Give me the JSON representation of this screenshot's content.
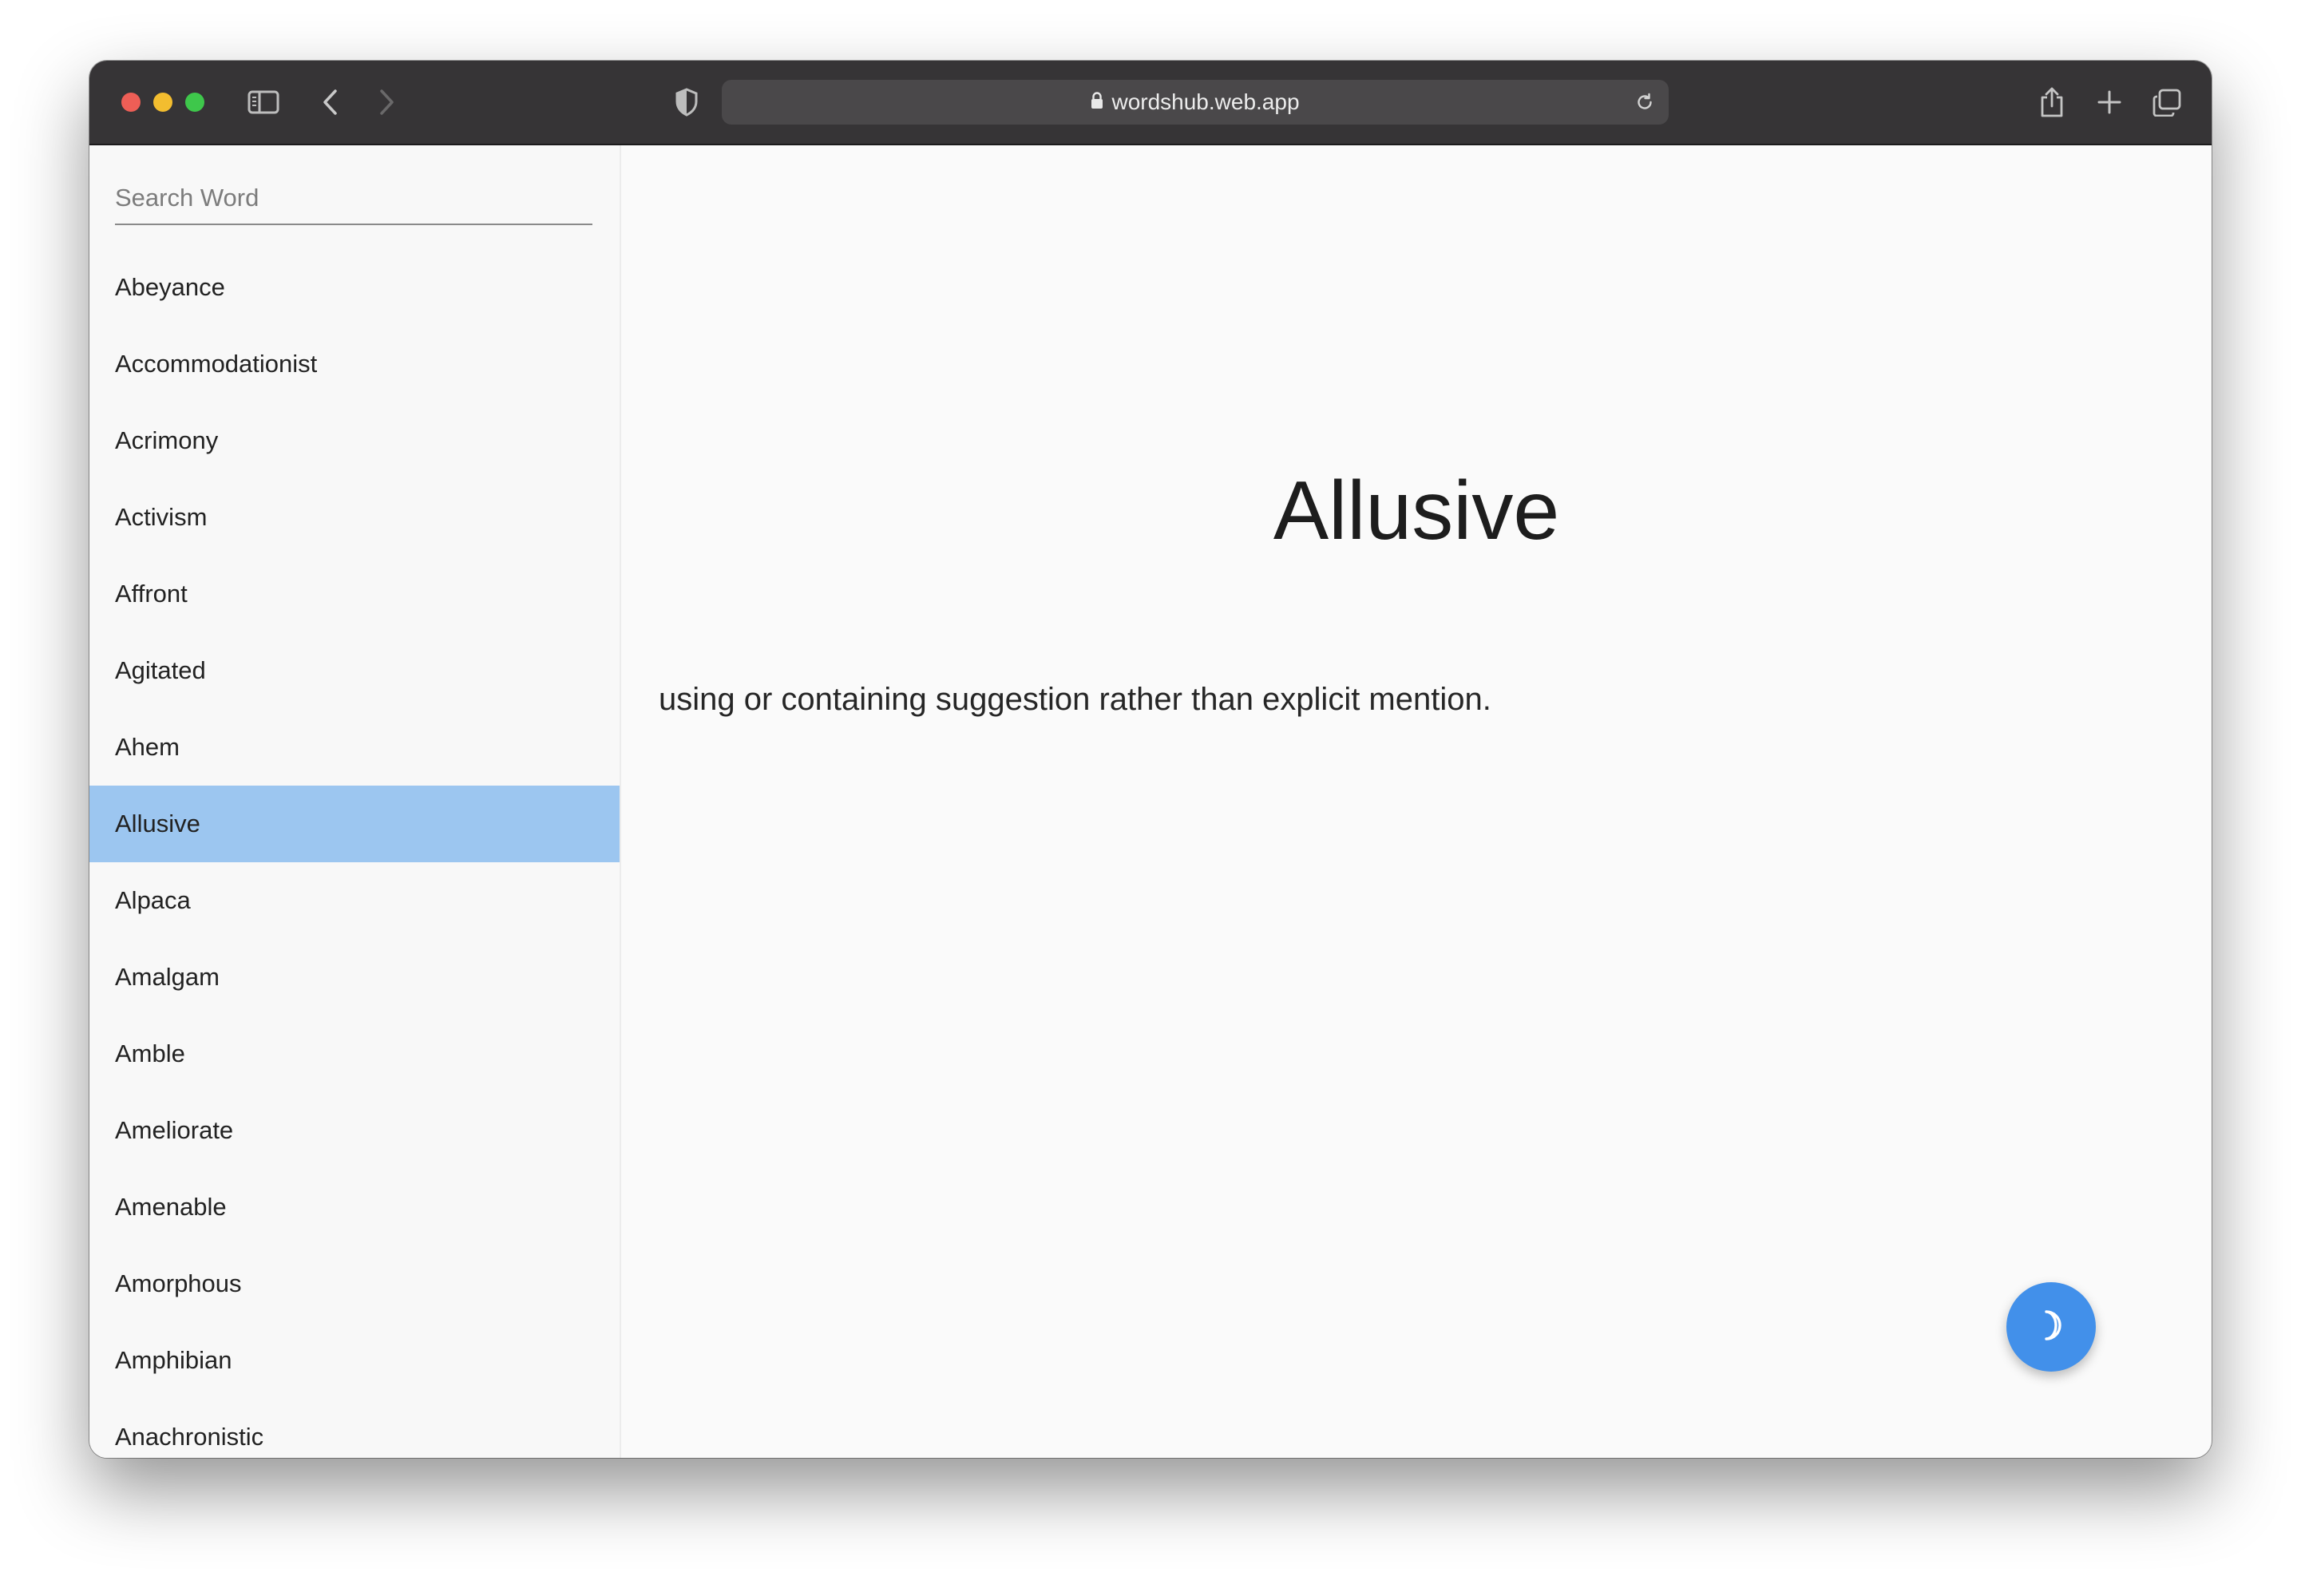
{
  "browser": {
    "url": "wordshub.web.app",
    "icons": {
      "close": "close-button",
      "minimize": "minimize-button",
      "zoom": "zoom-button",
      "sidebar": "sidebar-toggle-icon",
      "back": "chevron-left-icon",
      "forward": "chevron-right-icon",
      "privacy": "shield-icon",
      "lock": "lock-icon",
      "reload": "reload-icon",
      "share": "share-icon",
      "new_tab": "plus-icon",
      "tabs": "tab-overview-icon"
    }
  },
  "sidebar": {
    "search_placeholder": "Search Word",
    "search_value": "",
    "words": [
      "Abeyance",
      "Accommodationist",
      "Acrimony",
      "Activism",
      "Affront",
      "Agitated",
      "Ahem",
      "Allusive",
      "Alpaca",
      "Amalgam",
      "Amble",
      "Ameliorate",
      "Amenable",
      "Amorphous",
      "Amphibian",
      "Anachronistic"
    ],
    "selected_word": "Allusive"
  },
  "main": {
    "word": "Allusive",
    "definition": "using or containing suggestion rather than explicit mention."
  },
  "fab": {
    "icon": "moon-icon",
    "action": "toggle dark mode"
  },
  "colors": {
    "titlebar": "#363436",
    "selected_row": "#9cc6f0",
    "fab": "#4290ea",
    "traffic_red": "#ee5e56",
    "traffic_yellow": "#f3bd2f",
    "traffic_green": "#3ec74b"
  }
}
